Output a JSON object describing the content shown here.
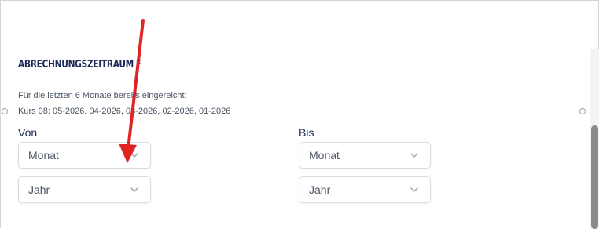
{
  "section": {
    "title": "Abrechnungszeitraum *",
    "info_line1": "Für die letzten 6 Monate bereits eingereicht:",
    "info_line2": "Kurs 08: 05-2026, 04-2026, 03-2026, 02-2026, 01-2026"
  },
  "from": {
    "label": "Von",
    "month_value": "Monat",
    "year_value": "Jahr"
  },
  "to": {
    "label": "Bis",
    "month_value": "Monat",
    "year_value": "Jahr"
  },
  "annotation": {
    "arrow_color": "#e02424"
  },
  "colors": {
    "heading": "#1b2a57",
    "border": "#d9dde3"
  },
  "icons": {
    "dropdown": "chevron-down-icon",
    "resize": "resize-handle-icon"
  }
}
